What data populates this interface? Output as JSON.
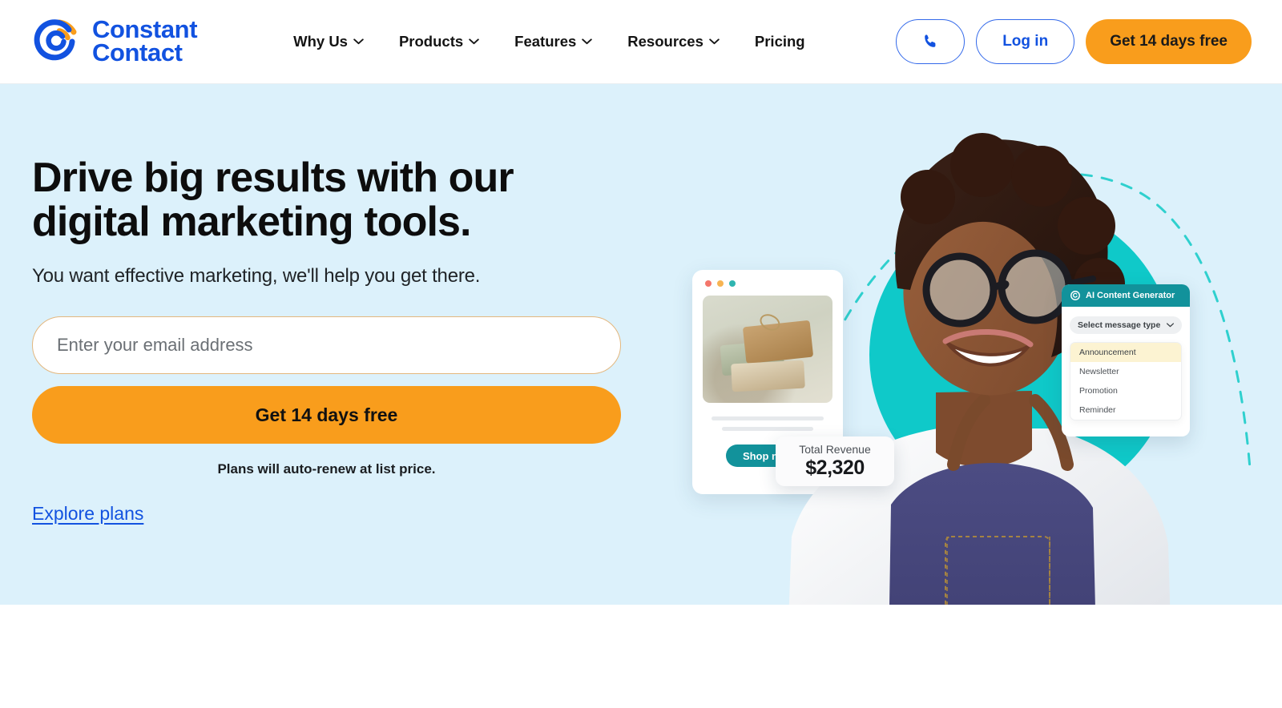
{
  "header": {
    "logo": {
      "line1": "Constant",
      "line2": "Contact",
      "mark_icon": "constant-contact-logo-icon",
      "brand_blue": "#1252E0",
      "brand_orange": "#F99D1C"
    },
    "nav": [
      {
        "label": "Why Us",
        "has_dropdown": true,
        "icon": "chevron-down-icon"
      },
      {
        "label": "Products",
        "has_dropdown": true,
        "icon": "chevron-down-icon"
      },
      {
        "label": "Features",
        "has_dropdown": true,
        "icon": "chevron-down-icon"
      },
      {
        "label": "Resources",
        "has_dropdown": true,
        "icon": "chevron-down-icon"
      },
      {
        "label": "Pricing",
        "has_dropdown": false,
        "icon": ""
      }
    ],
    "actions": {
      "phone_icon": "phone-icon",
      "login_label": "Log in",
      "trial_label": "Get 14 days free"
    }
  },
  "hero": {
    "background_color": "#DCF1FB",
    "headline": "Drive big results with our digital marketing tools.",
    "subheadline": "You want effective marketing, we'll help you get there.",
    "email_placeholder": "Enter your email address",
    "email_value": "",
    "cta_label": "Get 14 days free",
    "fine_print": "Plans will auto-renew at list price.",
    "explore_link": "Explore plans",
    "cta_color": "#F99D1C",
    "link_color": "#1252E0"
  },
  "hero_art": {
    "accent_teal": "#0FC9C9",
    "dashed_arc_icon": "dashed-arc-decoration",
    "shop_card": {
      "window_dots": [
        "red",
        "orange",
        "teal"
      ],
      "photo_alt": "soap-bars-product-photo",
      "button_label": "Shop now",
      "button_color": "#12929B"
    },
    "revenue_card": {
      "label": "Total Revenue",
      "value": "$2,320"
    },
    "ai_panel": {
      "title": "AI Content Generator",
      "logo_icon": "constant-contact-mark-icon",
      "select_label": "Select message type",
      "select_icon": "chevron-down-icon",
      "options": [
        "Announcement",
        "Newsletter",
        "Promotion",
        "Reminder"
      ],
      "selected_option": "Announcement",
      "header_color": "#12929B",
      "highlight_color": "#FCF3D2"
    },
    "person_alt": "smiling-woman-in-denim-apron-photo"
  }
}
